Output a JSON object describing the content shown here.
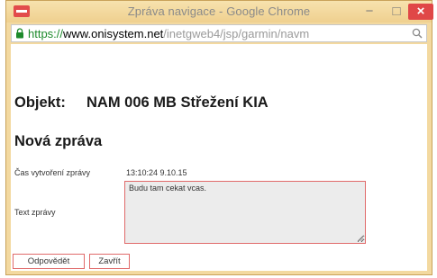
{
  "window": {
    "title": "Zpráva navigace - Google Chrome",
    "controls": {
      "minimize": "−",
      "maximize": "□",
      "close": "×"
    }
  },
  "address_bar": {
    "scheme": "https://",
    "domain": "www.onisystem.net",
    "path": "/inetgweb4/jsp/garmin/navm",
    "icons": [
      "lock-icon",
      "zoom-icon"
    ]
  },
  "page": {
    "object_label": "Objekt:",
    "object_value": "NAM 006 MB Střežení KIA",
    "heading": "Nová zpráva",
    "created_label": "Čas vytvoření zprávy",
    "created_value": "13:10:24   9.10.15",
    "message_label": "Text zprávy",
    "message_value": "Budu tam cekat vcas.",
    "reply_button": "Odpovědět",
    "close_button": "Zavřít"
  },
  "colors": {
    "titlebar": "#f3d9a0",
    "close_button": "#e04747",
    "field_border": "#e06a6a",
    "secure_scheme": "#1d8a2b"
  }
}
